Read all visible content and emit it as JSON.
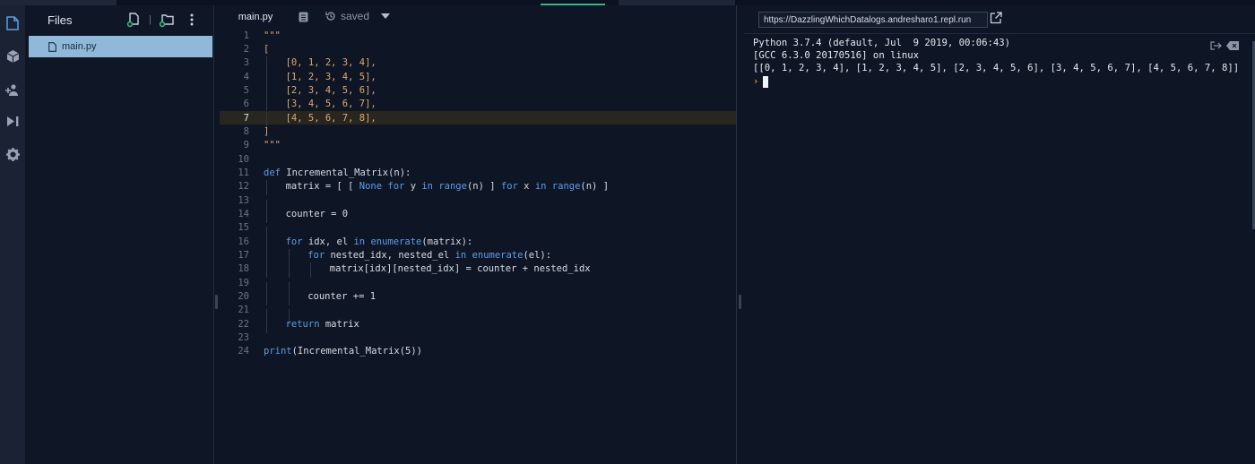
{
  "files_panel": {
    "title": "Files",
    "items": [
      {
        "label": "main.py",
        "selected": true
      }
    ]
  },
  "editor": {
    "tab_label": "main.py",
    "status": "saved",
    "active_line": 7,
    "lines": [
      {
        "n": "1",
        "tokens": [
          {
            "t": "\"\"\"",
            "c": "str"
          }
        ]
      },
      {
        "n": "2",
        "tokens": [
          {
            "t": "[",
            "c": "str"
          }
        ]
      },
      {
        "n": "3",
        "indent": 1,
        "tokens": [
          {
            "t": "[0, 1, 2, 3, 4],",
            "c": "str"
          }
        ]
      },
      {
        "n": "4",
        "indent": 1,
        "tokens": [
          {
            "t": "[1, 2, 3, 4, 5],",
            "c": "str"
          }
        ]
      },
      {
        "n": "5",
        "indent": 1,
        "tokens": [
          {
            "t": "[2, 3, 4, 5, 6],",
            "c": "str"
          }
        ]
      },
      {
        "n": "6",
        "indent": 1,
        "tokens": [
          {
            "t": "[3, 4, 5, 6, 7],",
            "c": "str"
          }
        ]
      },
      {
        "n": "7",
        "indent": 1,
        "tokens": [
          {
            "t": "[4, 5, 6, 7, 8],",
            "c": "str"
          }
        ]
      },
      {
        "n": "8",
        "tokens": [
          {
            "t": "]",
            "c": "str"
          }
        ]
      },
      {
        "n": "9",
        "tokens": [
          {
            "t": "\"\"\"",
            "c": "str"
          }
        ]
      },
      {
        "n": "10",
        "tokens": []
      },
      {
        "n": "11",
        "tokens": [
          {
            "t": "def",
            "c": "kw"
          },
          {
            "t": " Incremental_Matrix(n):",
            "c": "fn"
          }
        ]
      },
      {
        "n": "12",
        "indent": 1,
        "tokens": [
          {
            "t": "matrix = [ [ ",
            "c": "fn"
          },
          {
            "t": "None",
            "c": "kw"
          },
          {
            "t": " ",
            "c": "fn"
          },
          {
            "t": "for",
            "c": "kw"
          },
          {
            "t": " y ",
            "c": "fn"
          },
          {
            "t": "in",
            "c": "kw"
          },
          {
            "t": " ",
            "c": "fn"
          },
          {
            "t": "range",
            "c": "kw"
          },
          {
            "t": "(n) ] ",
            "c": "fn"
          },
          {
            "t": "for",
            "c": "kw"
          },
          {
            "t": " x ",
            "c": "fn"
          },
          {
            "t": "in",
            "c": "kw"
          },
          {
            "t": " ",
            "c": "fn"
          },
          {
            "t": "range",
            "c": "kw"
          },
          {
            "t": "(n) ]",
            "c": "fn"
          }
        ]
      },
      {
        "n": "13",
        "indent": 1,
        "tokens": []
      },
      {
        "n": "14",
        "indent": 1,
        "tokens": [
          {
            "t": "counter = 0",
            "c": "fn"
          }
        ]
      },
      {
        "n": "15",
        "indent": 1,
        "tokens": []
      },
      {
        "n": "16",
        "indent": 1,
        "tokens": [
          {
            "t": "for",
            "c": "kw"
          },
          {
            "t": " idx, el ",
            "c": "fn"
          },
          {
            "t": "in",
            "c": "kw"
          },
          {
            "t": " ",
            "c": "fn"
          },
          {
            "t": "enumerate",
            "c": "kw"
          },
          {
            "t": "(matrix):",
            "c": "fn"
          }
        ]
      },
      {
        "n": "17",
        "indent": 2,
        "tokens": [
          {
            "t": "for",
            "c": "kw"
          },
          {
            "t": " nested_idx, nested_el ",
            "c": "fn"
          },
          {
            "t": "in",
            "c": "kw"
          },
          {
            "t": " ",
            "c": "fn"
          },
          {
            "t": "enumerate",
            "c": "kw"
          },
          {
            "t": "(el):",
            "c": "fn"
          }
        ]
      },
      {
        "n": "18",
        "indent": 3,
        "tokens": [
          {
            "t": "matrix[idx][nested_idx] = counter + nested_idx",
            "c": "fn"
          }
        ]
      },
      {
        "n": "19",
        "indent": 2,
        "tokens": []
      },
      {
        "n": "20",
        "indent": 2,
        "tokens": [
          {
            "t": "counter += 1",
            "c": "fn"
          }
        ]
      },
      {
        "n": "21",
        "indent": 2,
        "tokens": []
      },
      {
        "n": "22",
        "indent": 1,
        "tokens": [
          {
            "t": "return",
            "c": "kw"
          },
          {
            "t": " matrix",
            "c": "fn"
          }
        ]
      },
      {
        "n": "23",
        "tokens": []
      },
      {
        "n": "24",
        "tokens": [
          {
            "t": "print",
            "c": "kw"
          },
          {
            "t": "(Incremental_Matrix(5))",
            "c": "fn"
          }
        ]
      }
    ]
  },
  "console": {
    "url": "https://DazzlingWhichDatalogs.andresharo1.repl.run",
    "output": [
      "Python 3.7.4 (default, Jul  9 2019, 00:06:43)",
      "[GCC 6.3.0 20170516] on linux",
      "[[0, 1, 2, 3, 4], [1, 2, 3, 4, 5], [2, 3, 4, 5, 6], [3, 4, 5, 6, 7], [4, 5, 6, 7, 8]]"
    ],
    "prompt_symbol": "›"
  },
  "colors": {
    "background": "#0e1525",
    "activity_bar": "#1a2233",
    "selected_file": "#8fb8d9",
    "string": "#e0a76f",
    "keyword": "#5a9fe6",
    "active_line": "#28261f",
    "prompt": "#f08a2c"
  },
  "icons": {
    "activity": [
      "files-icon",
      "packages-icon",
      "multiplayer-icon",
      "debugger-icon",
      "settings-icon"
    ],
    "files_toolbar": [
      "add-file-icon",
      "add-folder-icon",
      "more-options-icon"
    ],
    "editor_toolbar": [
      "document-icon",
      "history-icon",
      "chevron-down-icon"
    ],
    "console_toolbar": [
      "open-external-icon",
      "exit-icon",
      "clear-console-icon"
    ]
  }
}
